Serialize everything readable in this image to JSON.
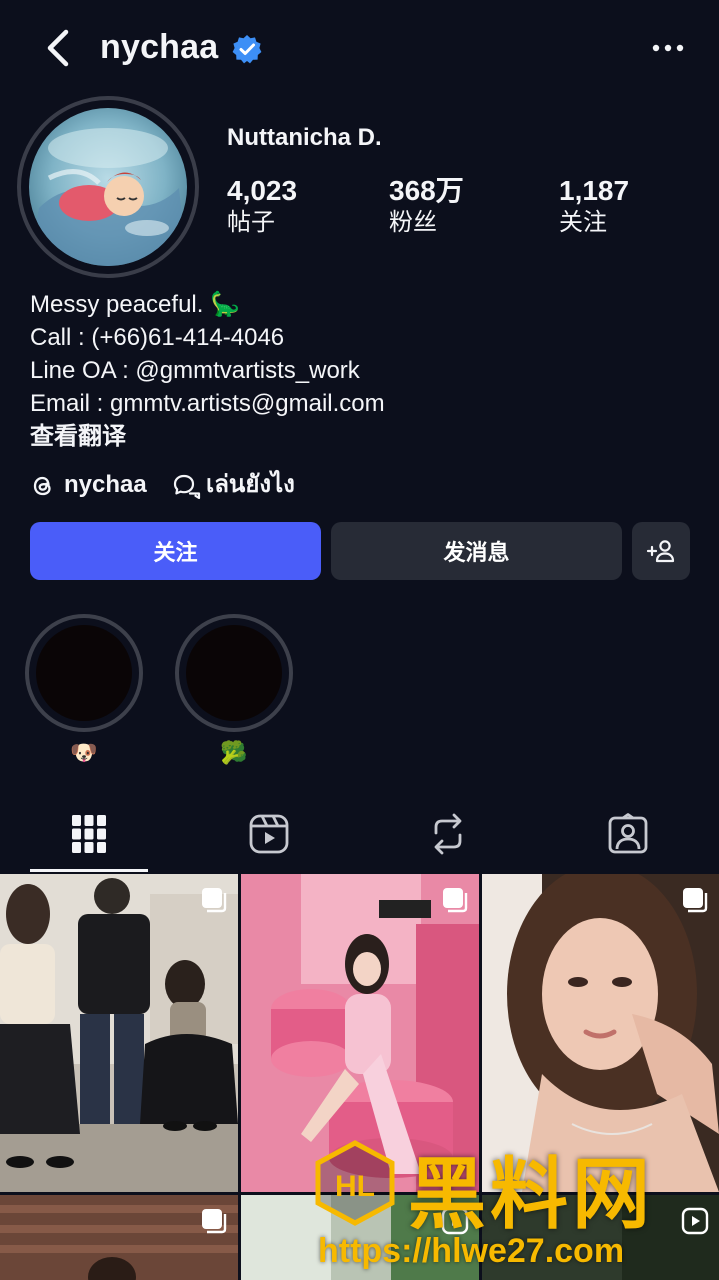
{
  "header": {
    "username": "nychaa",
    "back_icon": "chevron-left-icon",
    "verified_icon": "verified-badge-icon",
    "more_icon": "more-horizontal-icon"
  },
  "profile": {
    "full_name": "Nuttanicha D.",
    "stats": [
      {
        "value": "4,023",
        "label": "帖子"
      },
      {
        "value": "368万",
        "label": "粉丝"
      },
      {
        "value": "1,187",
        "label": "关注"
      }
    ],
    "bio": [
      "Messy peaceful. 🦕",
      "Call : (+66)61-414-4046",
      "Line OA : @gmmtvartists_work",
      "Email : gmmtv.artists@gmail.com"
    ],
    "translate_label": "查看翻译",
    "threads_handle": "nychaa",
    "thread_link": "เล่นยังไง"
  },
  "actions": {
    "follow_label": "关注",
    "message_label": "发消息",
    "add_user_icon": "add-person-icon"
  },
  "highlights": [
    {
      "emoji": "🐶"
    },
    {
      "emoji": "🥦"
    }
  ],
  "tabs": [
    {
      "icon": "grid-icon",
      "active": true
    },
    {
      "icon": "reels-icon",
      "active": false
    },
    {
      "icon": "repost-icon",
      "active": false
    },
    {
      "icon": "tagged-icon",
      "active": false
    }
  ],
  "watermark": {
    "text": "黑料网",
    "url": "https://hlwe27.com",
    "logo_letters": "HL"
  },
  "colors": {
    "background": "#0c0f1c",
    "follow_button": "#4a5df9",
    "secondary_button": "#272b36",
    "verified": "#3d8ff6",
    "watermark": "#f7b900"
  }
}
